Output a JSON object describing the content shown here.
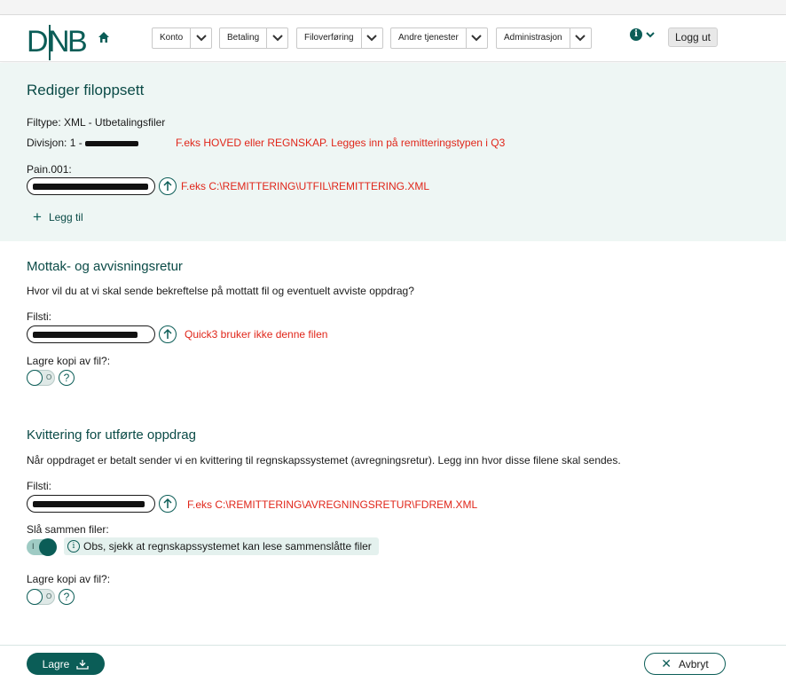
{
  "header": {
    "logo_text": "DNB",
    "nav": [
      {
        "label": "Konto"
      },
      {
        "label": "Betaling"
      },
      {
        "label": "Filoverføring"
      },
      {
        "label": "Andre tjenester"
      },
      {
        "label": "Administrasjon"
      }
    ],
    "logout_label": "Logg ut"
  },
  "edit": {
    "title": "Rediger filoppsett",
    "filetype_label": "Filtype:",
    "filetype_value": "XML - Utbetalingsfiler",
    "division_label": "Divisjon:",
    "division_value": "1 -",
    "division_note": "F.eks    HOVED eller REGNSKAP. Legges inn på remitteringstypen i Q3",
    "pain_label": "Pain.001:",
    "pain_value": "C:\\Remittering\\remittering.xml",
    "pain_note": "F.eks    C:\\REMITTERING\\UTFIL\\REMITTERING.XML",
    "add_label": "Legg til"
  },
  "receipt": {
    "title": "Mottak- og avvisningsretur",
    "question": "Hvor vil du at vi skal sende bekreftelse på mottatt fil og eventuelt avviste oppdrag?",
    "path_label": "Filsti:",
    "path_value": "C:\\Remittering\\avvist.xml",
    "path_note": "Quick3 bruker ikke denne filen",
    "copy_label": "Lagre kopi av fil?:",
    "copy_enabled": false
  },
  "executed": {
    "title": "Kvittering for utførte oppdrag",
    "description": "Når oppdraget er betalt sender vi en kvittering til regnskapssystemet (avregningsretur). Legg inn hvor disse filene skal sendes.",
    "path_label": "Filsti:",
    "path_value": "C:\\Remittering\\fdrem.xml",
    "path_note": "F.eks    C:\\REMITTERING\\AVREGNINGSRETUR\\FDREM.XML",
    "merge_label": "Slå sammen filer:",
    "merge_enabled": true,
    "merge_notice": "Obs, sjekk at regnskapssystemet kan lese sammenslåtte filer",
    "copy_label": "Lagre kopi av fil?:",
    "copy_enabled": false
  },
  "footer": {
    "save_label": "Lagre",
    "cancel_label": "Avbryt"
  },
  "colors": {
    "brand": "#0b5d57",
    "annotation": "#e0261a",
    "section_bg": "#eef6f4"
  }
}
